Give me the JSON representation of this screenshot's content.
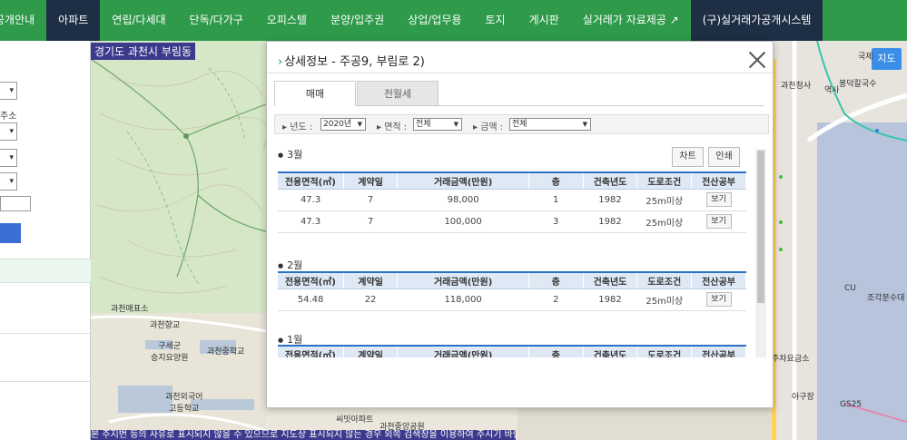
{
  "nav": {
    "items": [
      {
        "label": "공개안내",
        "dark": false
      },
      {
        "label": "아파트",
        "dark": true
      },
      {
        "label": "연립/다세대",
        "dark": false
      },
      {
        "label": "단독/다가구",
        "dark": false
      },
      {
        "label": "오피스텔",
        "dark": false
      },
      {
        "label": "분양/입주권",
        "dark": false
      },
      {
        "label": "상업/업무용",
        "dark": false
      },
      {
        "label": "토지",
        "dark": false
      },
      {
        "label": "게시판",
        "dark": false
      },
      {
        "label": "실거래가 자료제공 ↗",
        "dark": false
      },
      {
        "label": "(구)실거래가공개시스템",
        "dark": true
      }
    ]
  },
  "left": {
    "address_label": "주소",
    "select_value": "▾"
  },
  "map": {
    "location_title": "경기도 과천시 부림동",
    "map_button": "지도",
    "labels": {
      "post_office": "과천매표소",
      "hyang": "과천향교",
      "temple": "구세군\n승지요양원",
      "middle_school": "과천중학교",
      "foreign_high": "과천외국어\n고등학교",
      "apt": "씨밋아파트",
      "center_park": "과천중앙공원",
      "church": "국제",
      "cafe": "봉덕칼국수",
      "cu": "CU",
      "bunsik": "조각분수대",
      "post": "주차요금소",
      "agu": "아구장",
      "gs25": "GS25",
      "office": "과천청사",
      "office2": "역사"
    },
    "bottom_notice": "본 주지번 등의 사유로 표시되지 않을 수 있으므로 지도상 표시되지 않는 경우 외쪽 검색창을 이용하여 주시기 바랍니다."
  },
  "modal": {
    "title": "상세정보 - 주공9, 부림로 2)",
    "tabs": {
      "active": "매매",
      "inactive": "전월세"
    },
    "filters": {
      "year_label": "년도 :",
      "year_value": "2020년",
      "area_label": "면적 :",
      "area_value": "전체",
      "amount_label": "금액 :",
      "amount_value": "전체"
    },
    "chart_btn": "차트",
    "print_btn": "인쇄",
    "columns": [
      "전용면적(㎡)",
      "계약일",
      "거래금액(만원)",
      "층",
      "건축년도",
      "도로조건",
      "전산공부"
    ],
    "months": [
      {
        "label": "3월",
        "rows": [
          {
            "area": "47.3",
            "day": "7",
            "price": "98,000",
            "floor": "1",
            "year": "1982",
            "road": "25m미상",
            "view": "보기"
          },
          {
            "area": "47.3",
            "day": "7",
            "price": "100,000",
            "floor": "3",
            "year": "1982",
            "road": "25m미상",
            "view": "보기"
          }
        ]
      },
      {
        "label": "2월",
        "rows": [
          {
            "area": "54.48",
            "day": "22",
            "price": "118,000",
            "floor": "2",
            "year": "1982",
            "road": "25m미상",
            "view": "보기"
          }
        ]
      },
      {
        "label": "1월",
        "rows": []
      }
    ]
  }
}
